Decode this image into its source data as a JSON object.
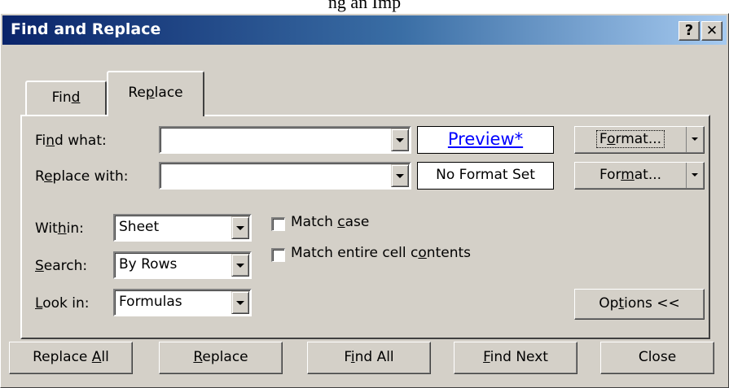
{
  "background": {
    "partial_text": "ng an Imp"
  },
  "window": {
    "title": "Find and Replace",
    "help_button": "?",
    "close_button": "✕"
  },
  "tabs": [
    {
      "label_pre": "Fin",
      "label_accel": "d",
      "label_post": "",
      "selected": false
    },
    {
      "label_pre": "Re",
      "label_accel": "p",
      "label_post": "lace",
      "selected": true
    }
  ],
  "find": {
    "label_pre": "Fi",
    "label_accel": "n",
    "label_post": "d what:",
    "value": "",
    "preview_text": "Preview*",
    "format_button": {
      "pre": "F",
      "accel": "o",
      "post": "rmat..."
    }
  },
  "replace": {
    "label_pre": "R",
    "label_accel": "e",
    "label_post": "place with:",
    "value": "",
    "preview_text": "No Format Set",
    "format_button": {
      "pre": "For",
      "accel": "m",
      "post": "at..."
    }
  },
  "options": {
    "within": {
      "label_pre": "Wit",
      "label_accel": "h",
      "label_post": "in:",
      "value": "Sheet"
    },
    "search": {
      "label_pre": "",
      "label_accel": "S",
      "label_post": "earch:",
      "value": "By Rows"
    },
    "look_in": {
      "label_pre": "",
      "label_accel": "L",
      "label_post": "ook in:",
      "value": "Formulas"
    },
    "match_case": {
      "pre": "Match ",
      "accel": "c",
      "post": "ase",
      "checked": false
    },
    "match_entire": {
      "pre": "Match entire cell c",
      "accel": "o",
      "post": "ntents",
      "checked": false
    },
    "options_button": {
      "pre": "Op",
      "accel": "t",
      "post": "ions <<"
    }
  },
  "buttons": {
    "replace_all": {
      "pre": "Replace ",
      "accel": "A",
      "post": "ll"
    },
    "replace": {
      "pre": "",
      "accel": "R",
      "post": "eplace"
    },
    "find_all": {
      "pre": "F",
      "accel": "i",
      "post": "nd All"
    },
    "find_next": {
      "pre": "",
      "accel": "F",
      "post": "ind Next"
    },
    "close": {
      "label": "Close"
    }
  },
  "colors": {
    "title_start": "#0a246a",
    "title_end": "#a6caf0",
    "dialog_face": "#d4d0c8",
    "preview_link": "#0000ff"
  }
}
